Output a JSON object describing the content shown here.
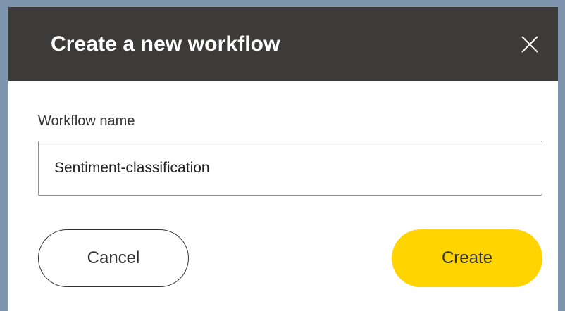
{
  "dialog": {
    "title": "Create a new workflow",
    "close_icon": "close-icon",
    "field": {
      "label": "Workflow name",
      "value": "Sentiment-classification"
    },
    "buttons": {
      "cancel_label": "Cancel",
      "create_label": "Create"
    },
    "colors": {
      "header_bg": "#3d3b39",
      "primary_button": "#ffd400",
      "backdrop": "#7f95ad"
    }
  }
}
